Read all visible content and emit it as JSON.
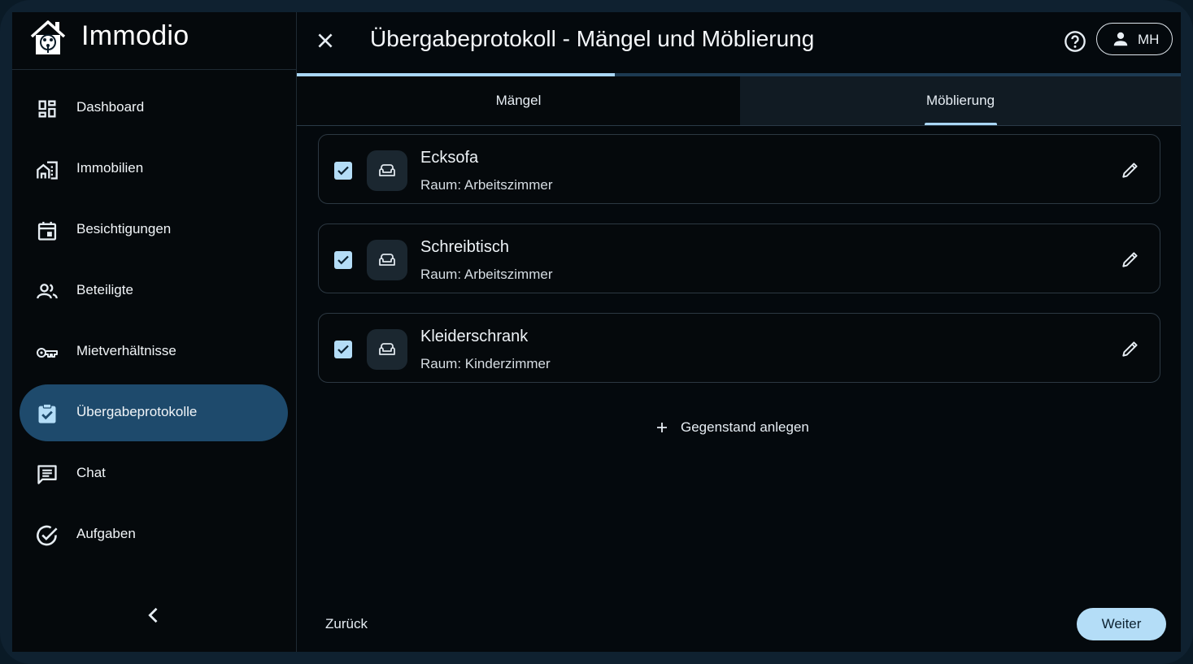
{
  "app": {
    "name": "Immodio"
  },
  "sidebar": {
    "items": [
      {
        "label": "Dashboard",
        "icon": "dashboard-icon"
      },
      {
        "label": "Immobilien",
        "icon": "buildings-icon"
      },
      {
        "label": "Besichtigungen",
        "icon": "calendar-icon"
      },
      {
        "label": "Beteiligte",
        "icon": "people-icon"
      },
      {
        "label": "Mietverhältnisse",
        "icon": "key-icon"
      },
      {
        "label": "Übergabeprotokolle",
        "icon": "clipboard-check-icon",
        "active": true
      },
      {
        "label": "Chat",
        "icon": "chat-icon"
      },
      {
        "label": "Aufgaben",
        "icon": "task-check-icon"
      }
    ]
  },
  "header": {
    "title": "Übergabeprotokoll - Mängel und Möblierung",
    "user_initials": "MH"
  },
  "progress": {
    "fraction": 0.36
  },
  "tabs": [
    {
      "label": "Mängel",
      "active": false
    },
    {
      "label": "Möblierung",
      "active": true
    }
  ],
  "items": [
    {
      "name": "Ecksofa",
      "room": "Raum: Arbeitszimmer",
      "checked": true
    },
    {
      "name": "Schreibtisch",
      "room": "Raum: Arbeitszimmer",
      "checked": true
    },
    {
      "name": "Kleiderschrank",
      "room": "Raum: Kinderzimmer",
      "checked": true
    }
  ],
  "actions": {
    "add_label": "Gegenstand anlegen",
    "back_label": "Zurück",
    "next_label": "Weiter"
  },
  "colors": {
    "accent": "#b4ddf7",
    "active_nav": "#1e4a6c",
    "background": "#04090d"
  }
}
